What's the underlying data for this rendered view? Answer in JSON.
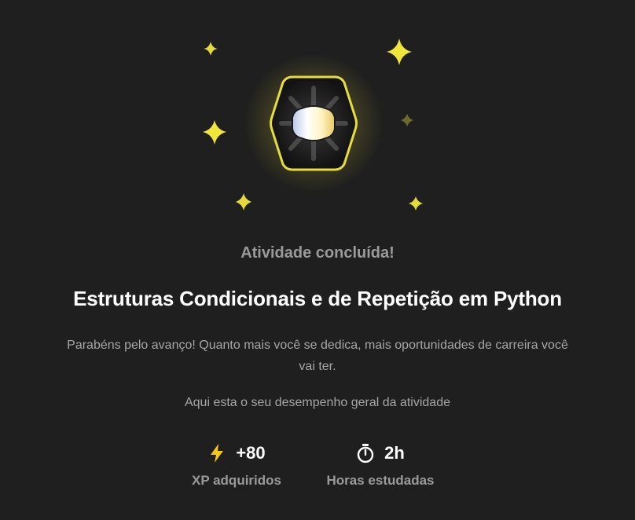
{
  "badge": {
    "icon": "achievement-badge-icon",
    "accent_color": "#f0e23a"
  },
  "completion": {
    "status_text": "Atividade concluída!",
    "course_title": "Estruturas Condicionais e de Repetição em Python",
    "congrats_message": "Parabéns pelo avanço! Quanto mais você se dedica, mais oportunidades de carreira você vai ter.",
    "summary_text": "Aqui esta o seu desempenho geral da atividade"
  },
  "stats": {
    "xp": {
      "icon": "lightning-icon",
      "value": "+80",
      "label": "XP adquiridos",
      "icon_color": "#f6c519"
    },
    "hours": {
      "icon": "stopwatch-icon",
      "value": "2h",
      "label": "Horas estudadas"
    }
  }
}
